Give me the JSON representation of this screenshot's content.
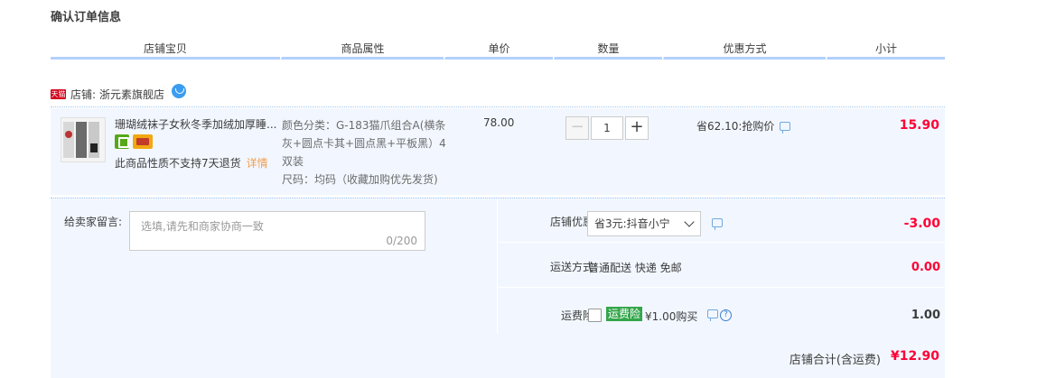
{
  "page": {
    "title": "确认订单信息"
  },
  "columns": [
    "店铺宝贝",
    "商品属性",
    "单价",
    "数量",
    "优惠方式",
    "小计"
  ],
  "shop": {
    "badge": "天猫",
    "label": "店铺:",
    "name": "浙元素旗舰店",
    "icon": "wangwang-icon"
  },
  "item": {
    "title": "珊瑚绒袜子女秋冬季加绒加厚睡...",
    "service_icons": [
      "guarantee-icon",
      "credit-card-icon"
    ],
    "note": "此商品性质不支持7天退货",
    "note_link": "详情",
    "attrs": {
      "color": "颜色分类：G-183猫爪组合A(横条灰+圆点卡其+圆点黑+平板黑）4双装",
      "size": "尺码：均码（收藏加购优先发货)"
    },
    "unit_price": "78.00",
    "quantity": "1",
    "qty_minus": "−",
    "qty_plus": "+",
    "discount": "省62.10:抢购价",
    "subtotal": "15.90"
  },
  "message": {
    "label": "给卖家留言:",
    "placeholder": "选填,请先和商家协商一致",
    "count": "0/200"
  },
  "shop_discount": {
    "label": "店铺优惠:",
    "value": "省3元:抖音小宁",
    "amount": "-3.00"
  },
  "shipping": {
    "label": "运送方式:",
    "value": "普通配送 快递 免邮",
    "amount": "0.00"
  },
  "insurance": {
    "label": "运费险:",
    "badge": "运费险",
    "text": "¥1.00购买",
    "amount": "1.00",
    "help": "?"
  },
  "total": {
    "label": "店铺合计(含运费)",
    "amount": "¥12.90"
  },
  "colors": {
    "accent_red": "#ff0036",
    "row_bg": "#f2f7ff",
    "header_line": "#b2d1ff",
    "insurance_green": "#33a64a"
  }
}
